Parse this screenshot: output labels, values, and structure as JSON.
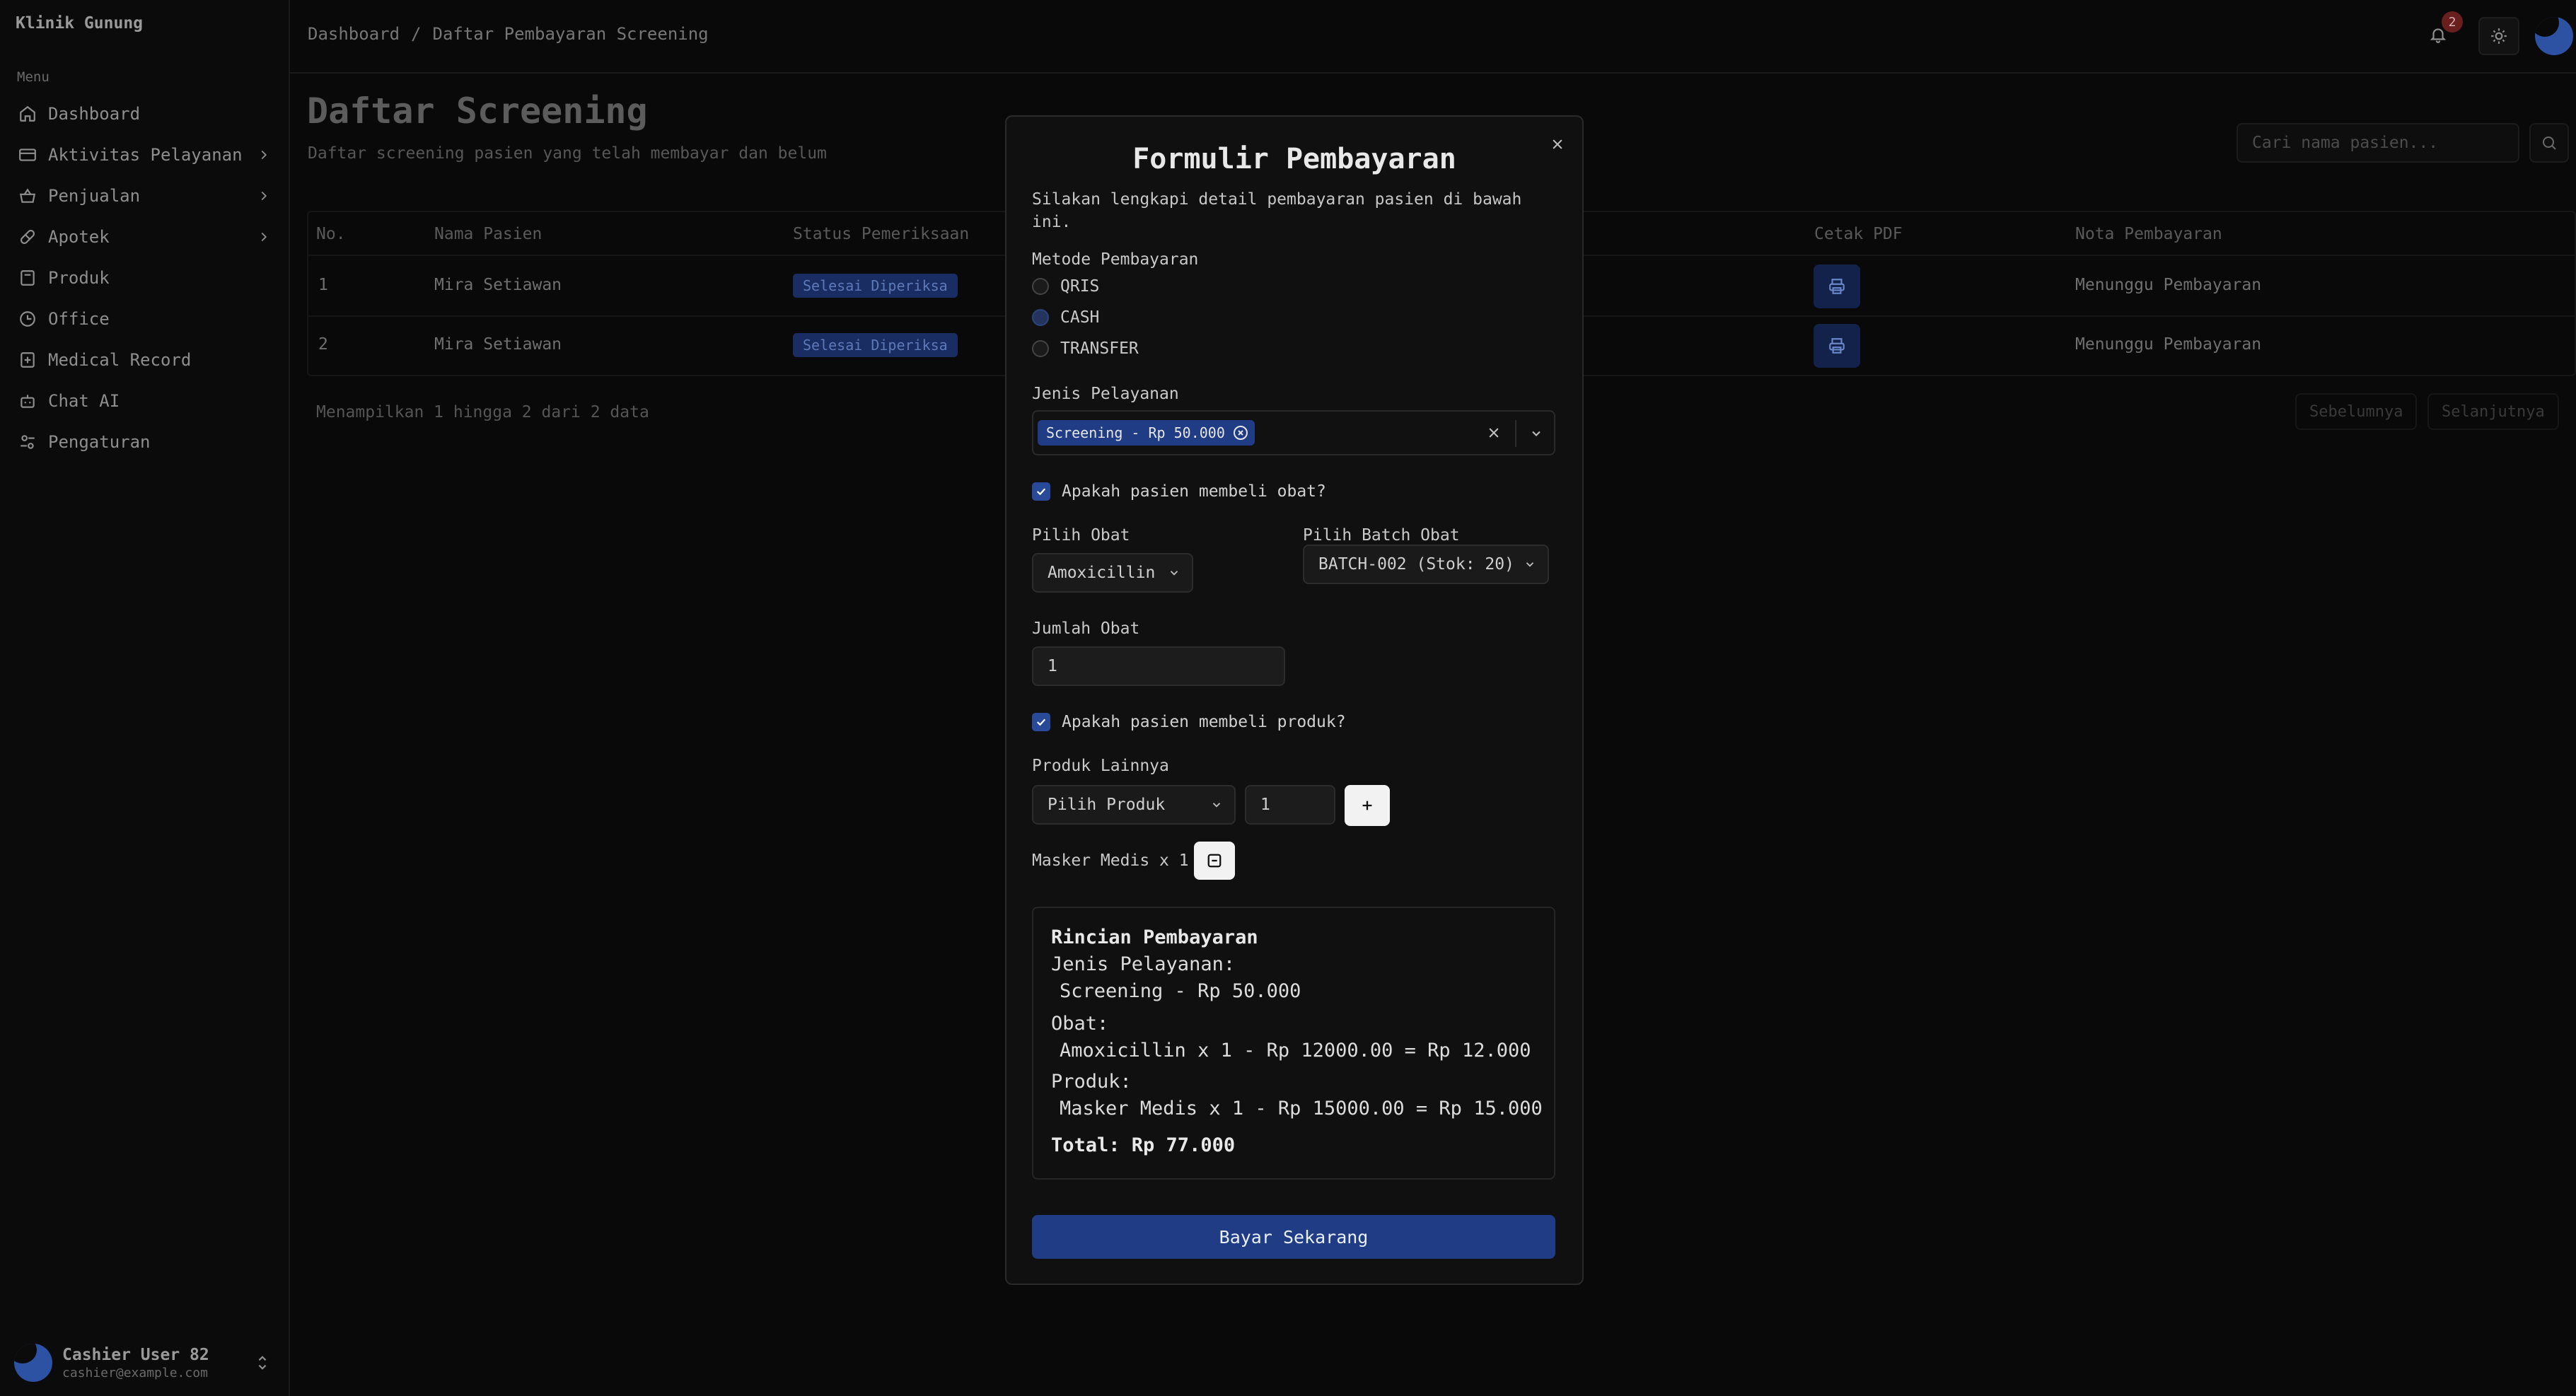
{
  "app": {
    "name": "Klinik Gunung",
    "menu_label": "Menu"
  },
  "sidebar": {
    "items": [
      {
        "label": "Dashboard",
        "icon": "home-icon",
        "submenu": false
      },
      {
        "label": "Aktivitas Pelayanan",
        "icon": "card-icon",
        "submenu": true
      },
      {
        "label": "Penjualan",
        "icon": "basket-icon",
        "submenu": true
      },
      {
        "label": "Apotek",
        "icon": "pill-icon",
        "submenu": true
      },
      {
        "label": "Produk",
        "icon": "package-icon",
        "submenu": false
      },
      {
        "label": "Office",
        "icon": "clock-icon",
        "submenu": false
      },
      {
        "label": "Medical Record",
        "icon": "medical-icon",
        "submenu": false
      },
      {
        "label": "Chat AI",
        "icon": "bot-icon",
        "submenu": false
      },
      {
        "label": "Pengaturan",
        "icon": "settings-icon",
        "submenu": false
      }
    ],
    "user": {
      "name": "Cashier User 82",
      "email": "cashier@example.com"
    }
  },
  "header": {
    "breadcrumb": [
      "Dashboard",
      "/",
      "Daftar Pembayaran Screening"
    ],
    "notification_count": "2"
  },
  "page": {
    "title": "Daftar Screening",
    "subtitle": "Daftar screening pasien yang telah membayar dan belum",
    "search_placeholder": "Cari nama pasien..."
  },
  "table": {
    "headers": [
      "No.",
      "Nama Pasien",
      "Status Pemeriksaan",
      "Cetak PDF",
      "Nota Pembayaran"
    ],
    "rows": [
      {
        "no": "1",
        "name": "Mira Setiawan",
        "status": "Selesai Diperiksa",
        "nota": "Menunggu Pembayaran"
      },
      {
        "no": "2",
        "name": "Mira Setiawan",
        "status": "Selesai Diperiksa",
        "nota": "Menunggu Pembayaran"
      }
    ],
    "footer": "Menampilkan 1 hingga 2 dari 2 data",
    "prev_label": "Sebelumnya",
    "next_label": "Selanjutnya"
  },
  "modal": {
    "title": "Formulir Pembayaran",
    "description": "Silakan lengkapi detail pembayaran pasien di bawah ini.",
    "payment_method_label": "Metode Pembayaran",
    "payment_methods": [
      "QRIS",
      "CASH",
      "TRANSFER"
    ],
    "selected_method": "CASH",
    "service_label": "Jenis Pelayanan",
    "service_chip": "Screening - Rp 50.000",
    "buy_medicine_label": "Apakah pasien membeli obat?",
    "medicine_label": "Pilih Obat",
    "medicine_value": "Amoxicillin",
    "batch_label": "Pilih Batch Obat",
    "batch_value": "BATCH-002 (Stok: 20)",
    "qty_label": "Jumlah Obat",
    "qty_value": "1",
    "buy_product_label": "Apakah pasien membeli produk?",
    "product_label": "Produk Lainnya",
    "product_placeholder": "Pilih Produk",
    "product_qty": "1",
    "product_added": "Masker Medis x 1",
    "summary": {
      "title": "Rincian Pembayaran",
      "service_heading": "Jenis Pelayanan:",
      "service_line": "Screening - Rp 50.000",
      "medicine_heading": "Obat:",
      "medicine_line": "Amoxicillin x 1 - Rp 12000.00 = Rp 12.000",
      "product_heading": "Produk:",
      "product_line": "Masker Medis x 1 - Rp 15000.00 = Rp 15.000",
      "total": "Total: Rp 77.000"
    },
    "pay_button": "Bayar Sekarang"
  },
  "colors": {
    "accent": "#1f3c85",
    "background": "#090909",
    "modal_bg": "#101010"
  }
}
